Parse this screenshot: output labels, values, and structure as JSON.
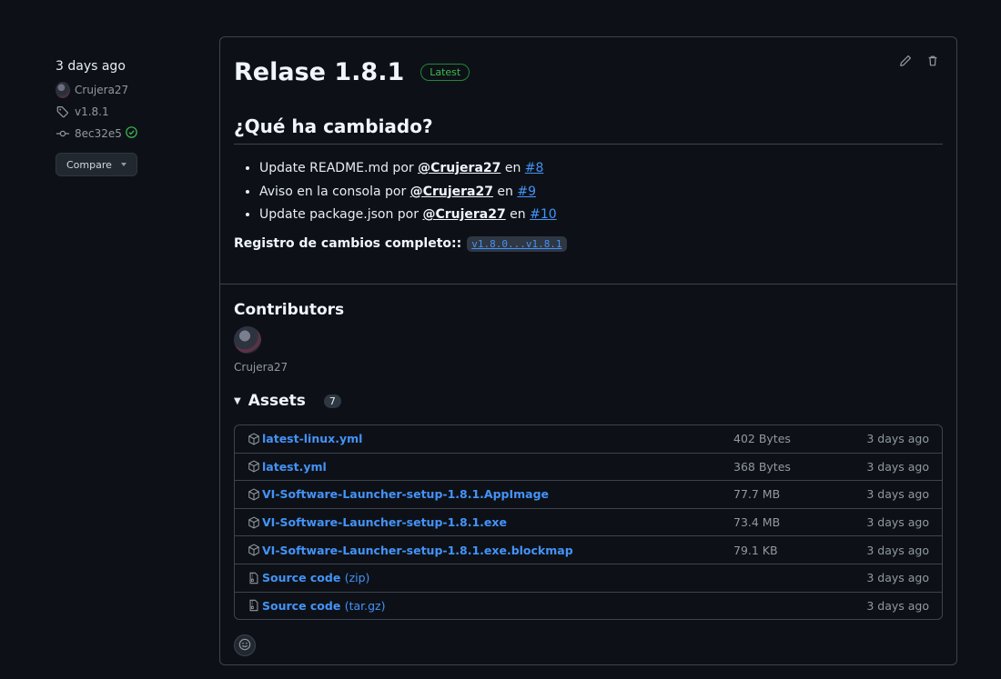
{
  "meta": {
    "date": "3 days ago",
    "author": "Crujera27",
    "tag": "v1.8.1",
    "commit": "8ec32e5",
    "compare_label": "Compare"
  },
  "release": {
    "title": "Relase 1.8.1",
    "badge": "Latest",
    "changes_heading": "¿Qué ha cambiado?",
    "changes": [
      {
        "text": "Update README.md por ",
        "user": "@Crujera27",
        "mid": " en ",
        "pr": "#8"
      },
      {
        "text": "Aviso en la consola por ",
        "user": "@Crujera27",
        "mid": " en ",
        "pr": "#9"
      },
      {
        "text": "Update package.json por ",
        "user": "@Crujera27",
        "mid": " en ",
        "pr": "#10"
      }
    ],
    "full_changelog_label": "Registro de cambios completo::",
    "full_changelog_link": "v1.8.0...v1.8.1"
  },
  "contributors": {
    "title": "Contributors",
    "names": [
      "Crujera27"
    ]
  },
  "assets": {
    "title": "Assets",
    "count": "7",
    "items": [
      {
        "name": "latest-linux.yml",
        "sub": "",
        "size": "402 Bytes",
        "date": "3 days ago",
        "icon": "package-icon"
      },
      {
        "name": "latest.yml",
        "sub": "",
        "size": "368 Bytes",
        "date": "3 days ago",
        "icon": "package-icon"
      },
      {
        "name": "VI-Software-Launcher-setup-1.8.1.AppImage",
        "sub": "",
        "size": "77.7 MB",
        "date": "3 days ago",
        "icon": "package-icon"
      },
      {
        "name": "VI-Software-Launcher-setup-1.8.1.exe",
        "sub": "",
        "size": "73.4 MB",
        "date": "3 days ago",
        "icon": "package-icon"
      },
      {
        "name": "VI-Software-Launcher-setup-1.8.1.exe.blockmap",
        "sub": "",
        "size": "79.1 KB",
        "date": "3 days ago",
        "icon": "package-icon"
      },
      {
        "name": "Source code",
        "sub": "(zip)",
        "size": "",
        "date": "3 days ago",
        "icon": "file-zip-icon"
      },
      {
        "name": "Source code",
        "sub": "(tar.gz)",
        "size": "",
        "date": "3 days ago",
        "icon": "file-zip-icon"
      }
    ]
  },
  "colors": {
    "background": "#0d1117",
    "link": "#4493f8",
    "success": "#3fb950",
    "border": "#3d444d"
  }
}
